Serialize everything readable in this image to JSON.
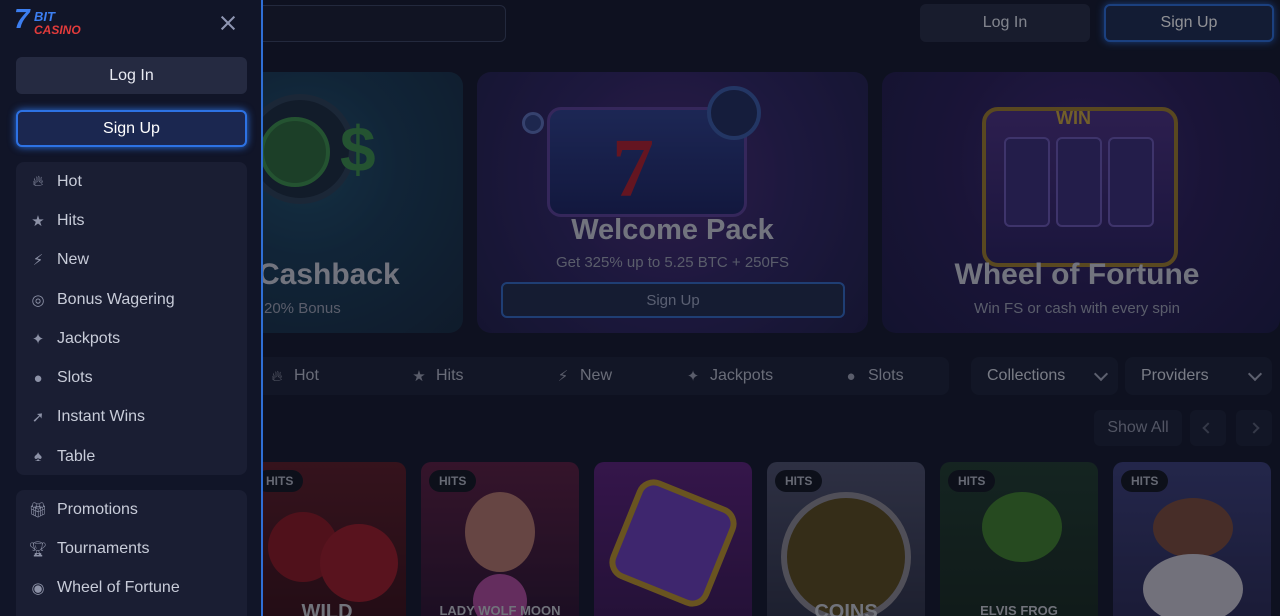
{
  "header": {
    "login_label": "Log In",
    "signup_label": "Sign Up"
  },
  "banners": [
    {
      "title": "Cashback",
      "subtitle": "20% Bonus"
    },
    {
      "title": "Welcome Pack",
      "subtitle": "Get 325% up to 5.25 BTC + 250FS",
      "button": "Sign Up"
    },
    {
      "title": "Wheel of Fortune",
      "subtitle": "Win FS or cash with every spin",
      "sign": "WIN"
    }
  ],
  "filters": {
    "items": [
      {
        "label": "Hot",
        "icon": "flame-icon"
      },
      {
        "label": "Hits",
        "icon": "stars-icon"
      },
      {
        "label": "New",
        "icon": "bolt-icon"
      },
      {
        "label": "Jackpots",
        "icon": "jackpot-icon"
      },
      {
        "label": "Slots",
        "icon": "cherry-icon"
      }
    ],
    "collections_label": "Collections",
    "providers_label": "Providers",
    "show_all_label": "Show All"
  },
  "games": [
    {
      "badge": "HITS",
      "name": "WILD"
    },
    {
      "badge": "HITS",
      "name": "LADY WOLF MOON"
    },
    {
      "badge": "",
      "name": ""
    },
    {
      "badge": "HITS",
      "name": "COINS"
    },
    {
      "badge": "HITS",
      "name": "ELVIS FROG"
    },
    {
      "badge": "HITS",
      "name": ""
    }
  ],
  "sidebar": {
    "logo": {
      "seven": "7",
      "bit": "BIT",
      "casino": "CASINO"
    },
    "login_label": "Log In",
    "signup_label": "Sign Up",
    "games_menu": [
      {
        "label": "Hot",
        "icon": "flame-icon"
      },
      {
        "label": "Hits",
        "icon": "stars-icon"
      },
      {
        "label": "New",
        "icon": "bolt-icon"
      },
      {
        "label": "Bonus Wagering",
        "icon": "target-icon"
      },
      {
        "label": "Jackpots",
        "icon": "jackpot-icon"
      },
      {
        "label": "Slots",
        "icon": "cherry-icon"
      },
      {
        "label": "Instant Wins",
        "icon": "rocket-icon"
      },
      {
        "label": "Table",
        "icon": "cards-icon"
      }
    ],
    "promo_menu": [
      {
        "label": "Promotions",
        "icon": "gift-icon"
      },
      {
        "label": "Tournaments",
        "icon": "trophy-icon"
      },
      {
        "label": "Wheel of Fortune",
        "icon": "wheel-icon"
      }
    ]
  },
  "colors": {
    "accent": "#2d72e4",
    "sidebar_bg": "#111528",
    "page_bg": "#13172a"
  }
}
